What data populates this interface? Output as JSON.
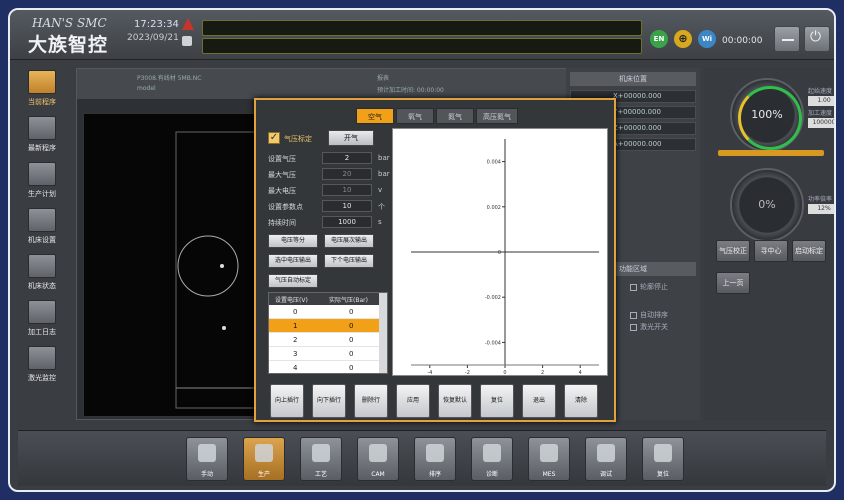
{
  "header": {
    "brand_en": "HAN'S SMC",
    "brand_cn": "大族智控",
    "time": "17:23:34",
    "date": "2023/09/21",
    "runtime": "00:00:00",
    "circles": [
      "EN",
      "⊕",
      "Wi"
    ]
  },
  "sidebar": {
    "items": [
      {
        "label": "当前程序",
        "icon": "program-icon",
        "active": true
      },
      {
        "label": "最新程序",
        "icon": "monitor-icon",
        "active": false
      },
      {
        "label": "生产计划",
        "icon": "clock-icon",
        "active": false
      },
      {
        "label": "机床设置",
        "icon": "settings-icon",
        "active": false
      },
      {
        "label": "机床状态",
        "icon": "status-icon",
        "active": false
      },
      {
        "label": "加工日志",
        "icon": "log-icon",
        "active": false
      },
      {
        "label": "激光监控",
        "icon": "laser-icon",
        "active": false
      }
    ]
  },
  "center": {
    "col_titles": [
      "P3008.有线材 5MB.NC",
      "报表"
    ],
    "col_sub": [
      "model",
      "预计加工时间: 00:00:00"
    ]
  },
  "right_panel": {
    "title": "机床位置",
    "coords": [
      "X+00000.000",
      "Y+00000.000",
      "Z+00000.000",
      "A+00000.000"
    ],
    "func_title": "功能区域",
    "checks": [
      "轮廓停止",
      "自动排序",
      "激光开关"
    ]
  },
  "far_right": {
    "gauge1": "100%",
    "gauge2": "0%",
    "lbl_a": "起始速度",
    "lbl_b": "加工速度",
    "lbl_c": "功率倍率",
    "box_a": "1.00",
    "box_b": "100000",
    "box_c": "12%",
    "btn_a": "气压校正",
    "btn_b": "寻中心",
    "btn_c": "启动标定",
    "btn_d": "上一页"
  },
  "dialog": {
    "tabs": [
      "空气",
      "氧气",
      "氮气",
      "高压氮气"
    ],
    "active_tab": 0,
    "calib_label": "气压标定",
    "open_gas_btn": "开气",
    "fields": [
      {
        "label": "设置气压",
        "value": "2",
        "unit": "bar",
        "dim": false
      },
      {
        "label": "最大气压",
        "value": "20",
        "unit": "bar",
        "dim": true
      },
      {
        "label": "最大电压",
        "value": "10",
        "unit": "v",
        "dim": true
      },
      {
        "label": "设置参数点",
        "value": "10",
        "unit": "个",
        "dim": false
      },
      {
        "label": "持续时间",
        "value": "1000",
        "unit": "s",
        "dim": false
      }
    ],
    "small_buttons": [
      "电压等分",
      "电压展次输出",
      "选中电压输出",
      "下个电压输出",
      "气压自动标定"
    ],
    "table": {
      "headers": [
        "设置电压(V)",
        "实际气压(Bar)"
      ],
      "rows": [
        [
          "0",
          "0"
        ],
        [
          "1",
          "0"
        ],
        [
          "2",
          "0"
        ],
        [
          "3",
          "0"
        ],
        [
          "4",
          "0"
        ]
      ],
      "selected": 1
    },
    "bottom_buttons": [
      "向上插行",
      "向下插行",
      "删除行",
      "应用",
      "恢复默认",
      "复位",
      "退出",
      "清除"
    ]
  },
  "chart_data": {
    "type": "line",
    "title": "",
    "xlabel": "",
    "ylabel": "",
    "xlim": [
      -5,
      5
    ],
    "ylim": [
      -0.005,
      0.005
    ],
    "x_ticks": [
      "-4",
      "-2",
      "0",
      "2",
      "4"
    ],
    "y_ticks": [
      "0.004",
      "0.002",
      "0",
      "-0.002",
      "-0.004"
    ],
    "series": []
  },
  "bottom_bar": {
    "items": [
      {
        "label": "手动",
        "active": false
      },
      {
        "label": "生产",
        "active": true
      },
      {
        "label": "工艺",
        "active": false
      },
      {
        "label": "CAM",
        "active": false
      },
      {
        "label": "排序",
        "active": false
      },
      {
        "label": "诊断",
        "active": false
      },
      {
        "label": "MES",
        "active": false
      },
      {
        "label": "调试",
        "active": false
      },
      {
        "label": "复位",
        "active": false
      }
    ]
  },
  "colors": {
    "accent": "#f2a018",
    "dialog_border": "#e0a13e",
    "page_bg": "#1f2f63"
  }
}
